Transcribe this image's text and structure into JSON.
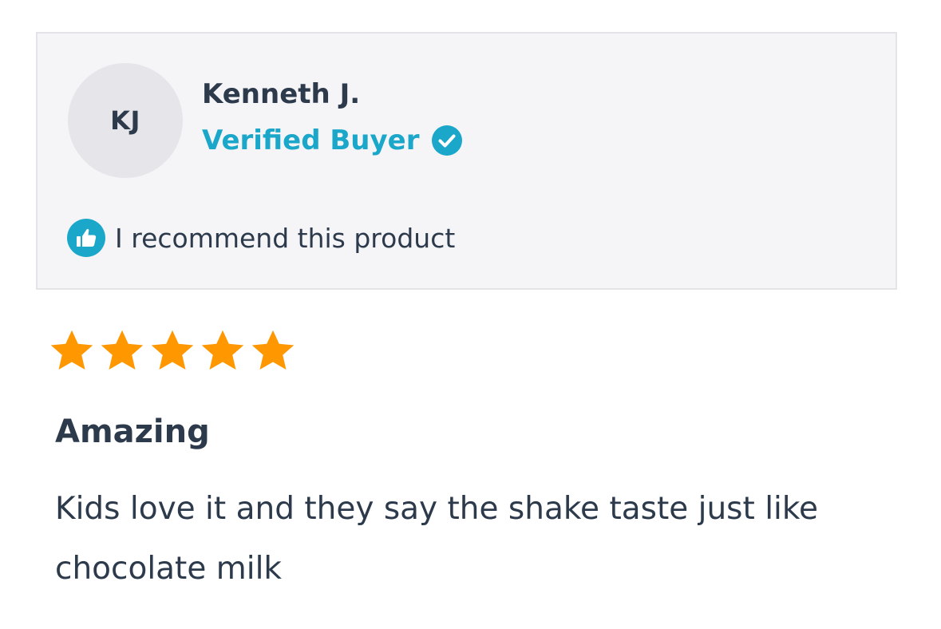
{
  "reviewer": {
    "initials": "KJ",
    "name": "Kenneth J.",
    "verified_label": "Verified Buyer",
    "verified_icon": "verified-check-icon",
    "recommend_text": "I recommend this product",
    "recommend_icon": "thumbs-up-icon"
  },
  "review": {
    "rating": 5,
    "rating_max": 5,
    "title": "Amazing",
    "body": "Kids love it and they say the shake taste just like chocolate milk"
  },
  "colors": {
    "accent": "#1ba7c9",
    "star": "#ff9800",
    "text": "#2c3a4b",
    "card_background": "#f5f5f8"
  }
}
